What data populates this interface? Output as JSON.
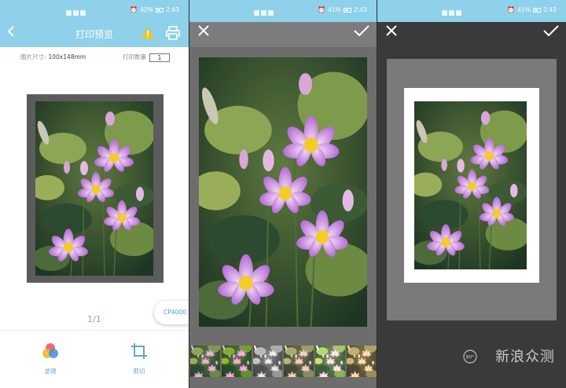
{
  "status_bar": {
    "battery_p1": "42%",
    "battery_p2": "41%",
    "battery_p3": "41%",
    "time": "2:43"
  },
  "preview": {
    "title": "打印预览",
    "size_label": "图片尺寸:",
    "size_value": "100x148mm",
    "qty_label": "打印数量",
    "qty_value": "1",
    "page_indicator": "1/1",
    "printer_model": "CP4000",
    "filter_label": "滤镜",
    "crop_label": "剪切",
    "icons": [
      "back-icon",
      "warning-icon",
      "printer-icon",
      "filter-icon",
      "crop-icon"
    ]
  },
  "filter_editor": {
    "icons": [
      "close-icon",
      "confirm-icon"
    ],
    "filter_count": 6
  },
  "crop_editor": {
    "icons": [
      "close-icon",
      "confirm-icon",
      "rotate-icon"
    ],
    "rotate_label": "90°",
    "watermark": "新浪众测"
  },
  "colors": {
    "header": "#8fd1ea",
    "accent": "#5fa7cf",
    "dark_panel": "#3a3a3a",
    "mid_panel": "#6d6d6d"
  }
}
